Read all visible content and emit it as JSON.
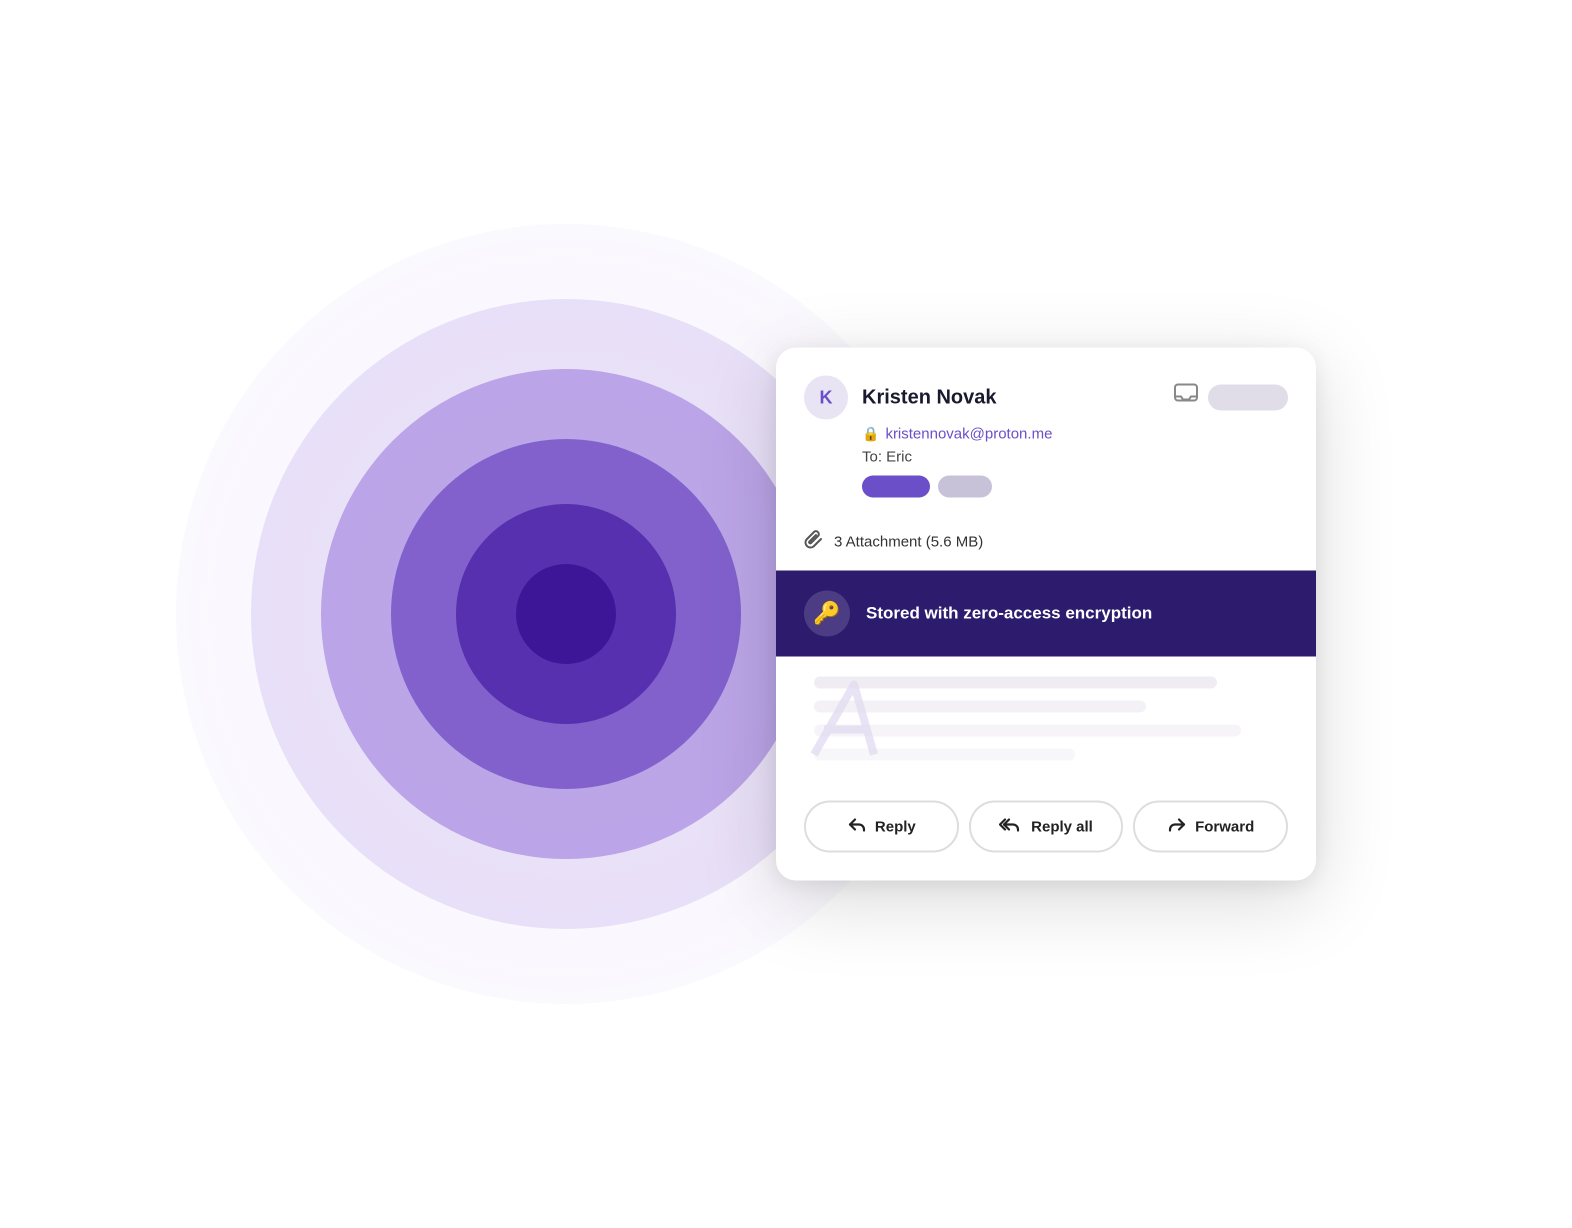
{
  "background": {
    "circles": [
      {
        "size": 780,
        "opacity": 0.12
      },
      {
        "size": 630,
        "opacity": 0.25
      },
      {
        "size": 490,
        "opacity": 0.45
      },
      {
        "size": 350,
        "opacity": 0.65
      },
      {
        "size": 220,
        "opacity": 0.85
      },
      {
        "size": 100,
        "opacity": 0.95
      }
    ]
  },
  "card": {
    "sender": {
      "initial": "K",
      "name": "Kristen Novak",
      "email": "kristennovak@proton.me",
      "to_label": "To: Eric"
    },
    "attachment": {
      "label": "3 Attachment (5.6 MB)"
    },
    "encryption": {
      "label": "Stored with zero-access encryption"
    },
    "actions": {
      "reply": "Reply",
      "reply_all": "Reply all",
      "forward": "Forward"
    }
  },
  "icons": {
    "inbox": "⊓",
    "lock": "🔒",
    "paperclip": "📎",
    "key": "🔑",
    "reply": "↩",
    "reply_all": "↪↩",
    "forward": "↪"
  }
}
